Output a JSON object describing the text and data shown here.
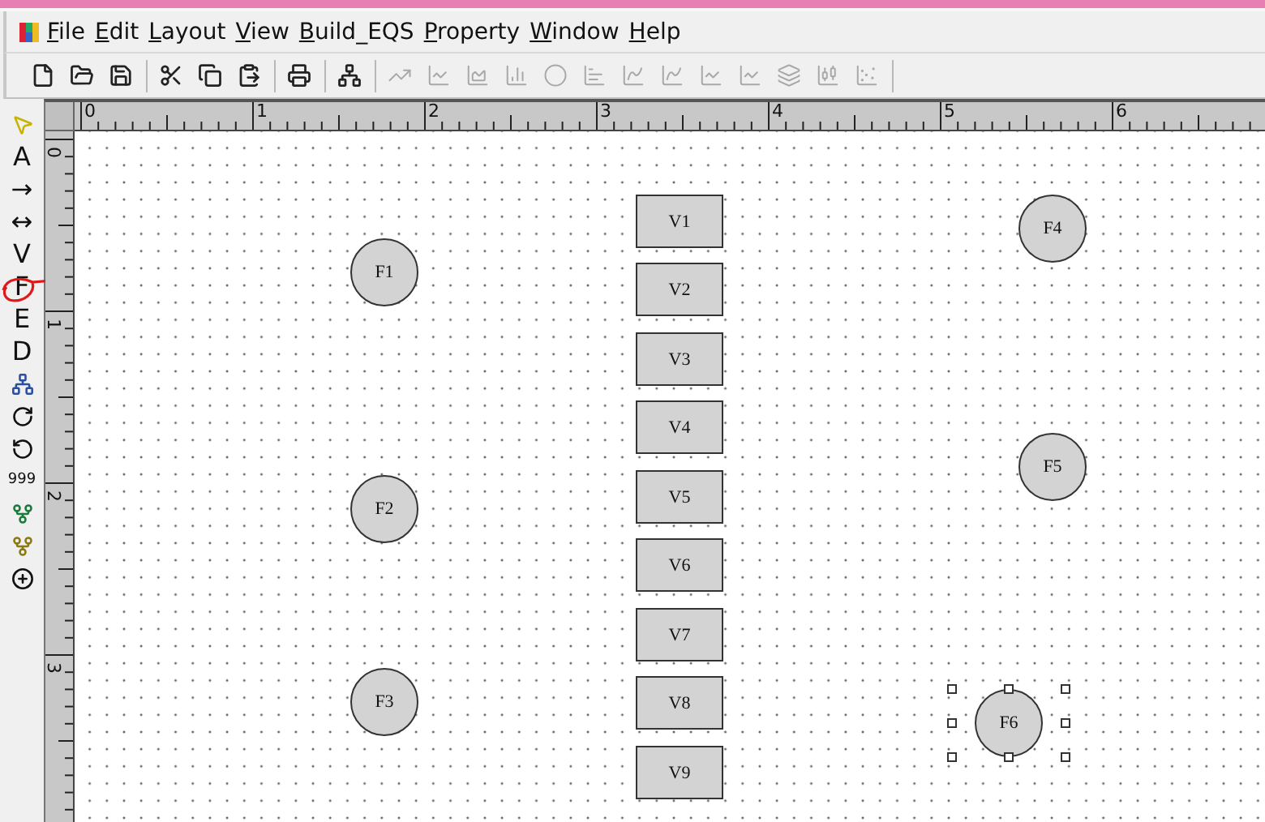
{
  "menu": [
    {
      "label": "File"
    },
    {
      "label": "Edit"
    },
    {
      "label": "Layout"
    },
    {
      "label": "View"
    },
    {
      "label": "Build_EQS"
    },
    {
      "label": "Property"
    },
    {
      "label": "Window"
    },
    {
      "label": "Help"
    }
  ],
  "toolbar": [
    [
      {
        "kind": "new",
        "disabled": false
      },
      {
        "kind": "open",
        "disabled": false
      },
      {
        "kind": "save",
        "disabled": false
      }
    ],
    [
      {
        "kind": "cut",
        "disabled": false
      },
      {
        "kind": "copy",
        "disabled": false
      },
      {
        "kind": "paste",
        "disabled": false
      }
    ],
    [
      {
        "kind": "print",
        "disabled": false
      }
    ],
    [
      {
        "kind": "build",
        "disabled": false
      }
    ],
    [
      {
        "kind": "trend",
        "disabled": true
      },
      {
        "kind": "line",
        "disabled": true
      },
      {
        "kind": "area",
        "disabled": true
      },
      {
        "kind": "column",
        "disabled": true
      },
      {
        "kind": "dot",
        "disabled": true
      },
      {
        "kind": "bar",
        "disabled": true
      },
      {
        "kind": "spline",
        "disabled": true
      },
      {
        "kind": "spline",
        "disabled": true
      },
      {
        "kind": "line",
        "disabled": true
      },
      {
        "kind": "line",
        "disabled": true
      },
      {
        "kind": "layers",
        "disabled": true
      },
      {
        "kind": "candle",
        "disabled": true
      },
      {
        "kind": "scatter",
        "disabled": true
      }
    ]
  ],
  "palette": [
    {
      "kind": "pointer"
    },
    {
      "kind": "text",
      "label": "A"
    },
    {
      "kind": "text",
      "label": "→"
    },
    {
      "kind": "text",
      "label": "↔"
    },
    {
      "kind": "text",
      "label": "V"
    },
    {
      "kind": "text",
      "label": "F"
    },
    {
      "kind": "text",
      "label": "E"
    },
    {
      "kind": "text",
      "label": "D"
    },
    {
      "kind": "network"
    },
    {
      "kind": "redo"
    },
    {
      "kind": "undo"
    },
    {
      "kind": "small",
      "label": "999"
    },
    {
      "kind": "tree"
    },
    {
      "kind": "tree2"
    },
    {
      "kind": "crosshair"
    }
  ],
  "rulers": {
    "horizontal": [
      "0",
      "1",
      "2",
      "3",
      "4",
      "5",
      "6"
    ],
    "vertical": [
      "0",
      "1",
      "2",
      "3"
    ]
  },
  "nodes": [
    {
      "kind": "factor",
      "label": "F1",
      "selected": false
    },
    {
      "kind": "factor",
      "label": "F2",
      "selected": false
    },
    {
      "kind": "factor",
      "label": "F3",
      "selected": false
    },
    {
      "kind": "factor",
      "label": "F4",
      "selected": false
    },
    {
      "kind": "factor",
      "label": "F5",
      "selected": false
    },
    {
      "kind": "factor",
      "label": "F6",
      "selected": true
    },
    {
      "kind": "variable",
      "label": "V1",
      "selected": false
    },
    {
      "kind": "variable",
      "label": "V2",
      "selected": false
    },
    {
      "kind": "variable",
      "label": "V3",
      "selected": false
    },
    {
      "kind": "variable",
      "label": "V4",
      "selected": false
    },
    {
      "kind": "variable",
      "label": "V5",
      "selected": false
    },
    {
      "kind": "variable",
      "label": "V6",
      "selected": false
    },
    {
      "kind": "variable",
      "label": "V7",
      "selected": false
    },
    {
      "kind": "variable",
      "label": "V8",
      "selected": false
    },
    {
      "kind": "variable",
      "label": "V9",
      "selected": false
    }
  ]
}
